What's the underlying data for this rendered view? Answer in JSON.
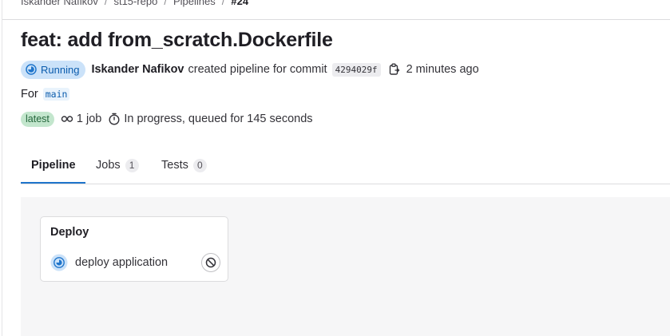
{
  "breadcrumb": [
    "Iskander Nafikov",
    "st15-repo",
    "Pipelines",
    "#24"
  ],
  "title": "feat: add from_scratch.Dockerfile",
  "pipeline": {
    "status": "Running",
    "author": "Iskander Nafikov",
    "action_text": "created pipeline for commit",
    "commit_sha": "4294029f",
    "time_ago": "2 minutes ago",
    "for_label": "For",
    "ref": "main",
    "latest_badge": "latest",
    "jobs_count": "1 job",
    "duration_text": "In progress, queued for 145 seconds"
  },
  "tabs": [
    {
      "label": "Pipeline",
      "count": null,
      "active": true
    },
    {
      "label": "Jobs",
      "count": "1",
      "active": false
    },
    {
      "label": "Tests",
      "count": "0",
      "active": false
    }
  ],
  "stage": {
    "name": "Deploy",
    "jobs": [
      {
        "name": "deploy application",
        "status": "running"
      }
    ]
  },
  "colors": {
    "running": "#1f75cb",
    "accent": "#1f75cb",
    "latest_bg": "#c3e6cd"
  }
}
